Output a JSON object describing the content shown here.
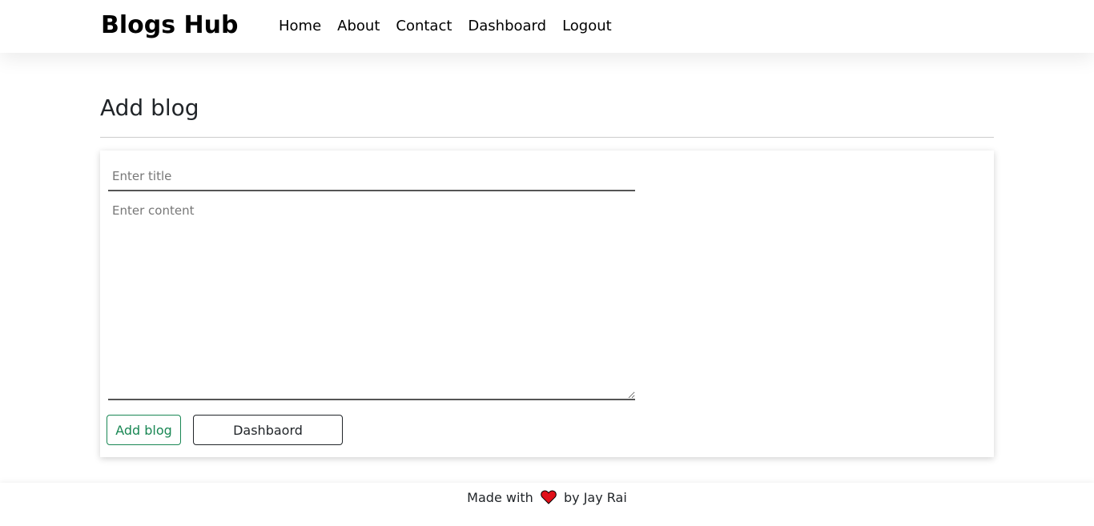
{
  "navbar": {
    "brand": "Blogs Hub",
    "links": [
      "Home",
      "About",
      "Contact",
      "Dashboard",
      "Logout"
    ]
  },
  "page": {
    "title": "Add blog"
  },
  "form": {
    "title_placeholder": "Enter title",
    "title_value": "",
    "content_placeholder": "Enter content",
    "content_value": "",
    "add_button": "Add blog",
    "dashboard_button": "Dashbaord"
  },
  "footer": {
    "prefix": "Made with",
    "icon": "heart-icon",
    "suffix": "by Jay Rai"
  },
  "colors": {
    "accent_green": "#198754",
    "heart_red": "#e0101a",
    "text_dark": "#212529"
  }
}
